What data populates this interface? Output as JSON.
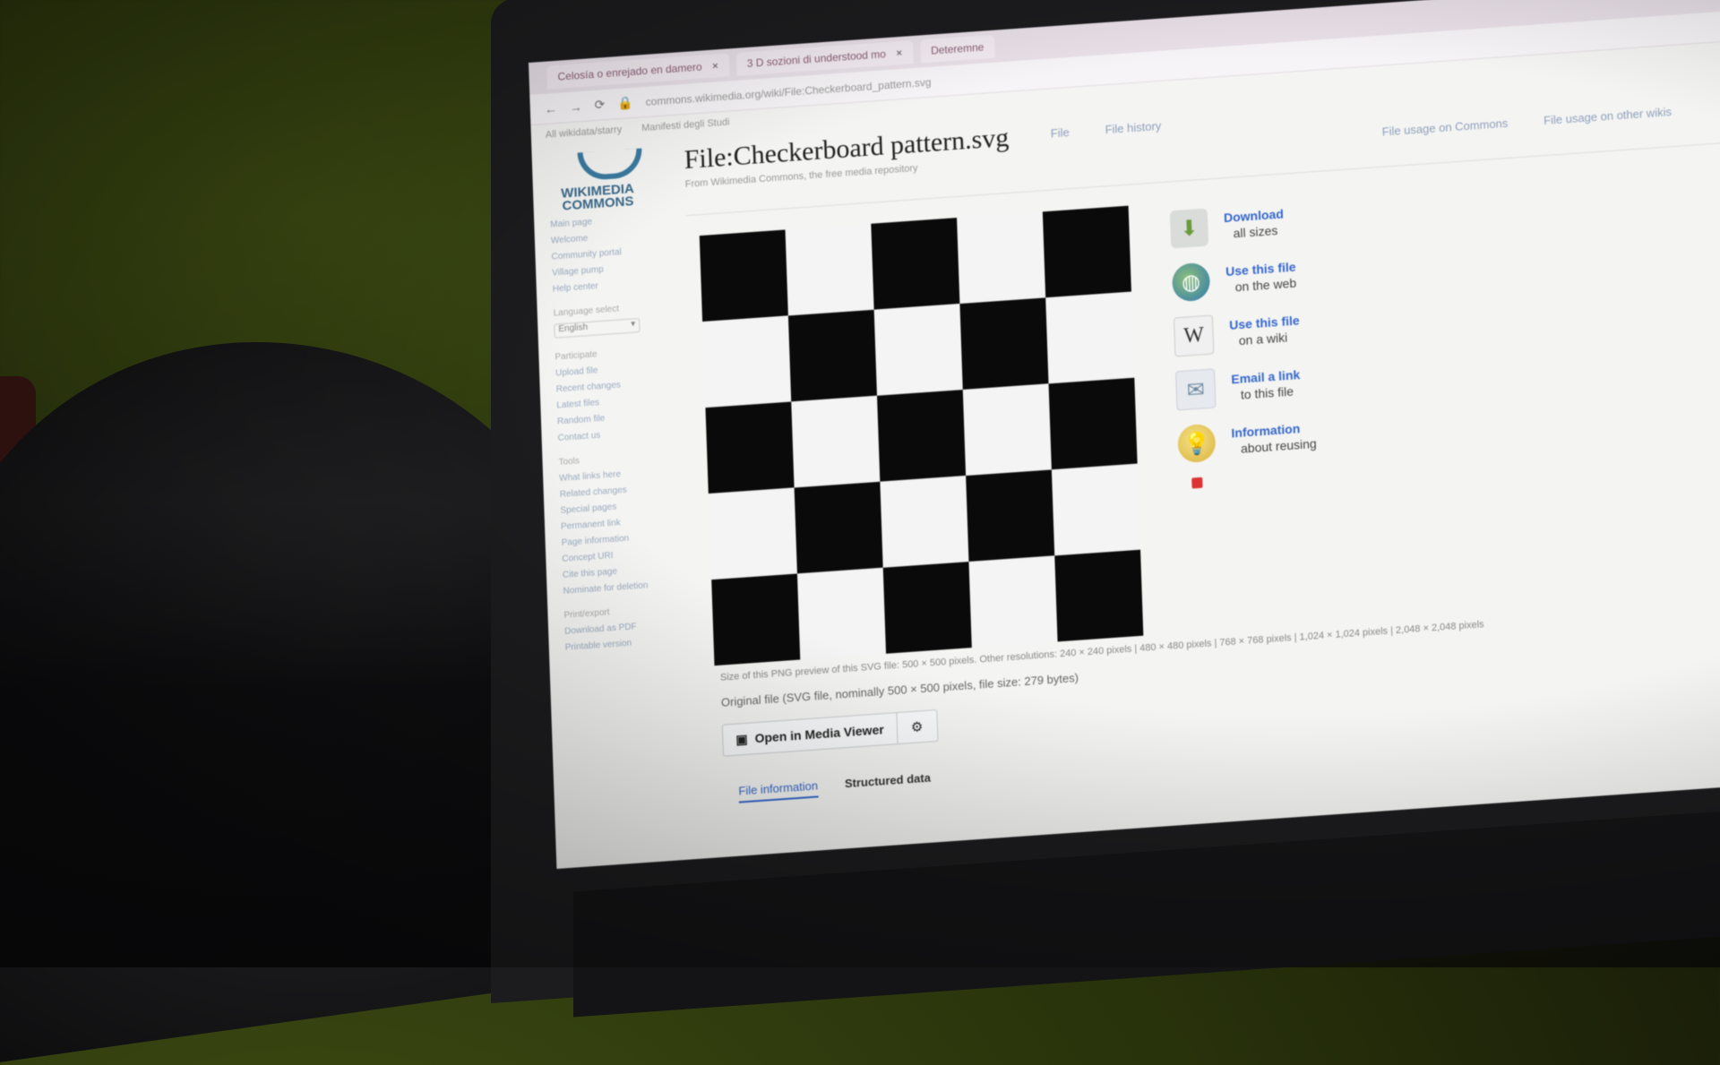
{
  "browser": {
    "tabs": [
      {
        "label": "Celosía o enrejado en damero",
        "close": "×"
      },
      {
        "label": "3 D sozioni di understood mo",
        "close": "×"
      },
      {
        "label": "Deteremne",
        "close": ""
      }
    ],
    "nav": {
      "back": "←",
      "forward": "→",
      "reload": "⟳",
      "lock": "🔒"
    },
    "url": "commons.wikimedia.org/wiki/File:Checkerboard_pattern.svg",
    "bookmarks": [
      "All   wikidata/starry",
      "Manifesti degli Studi"
    ]
  },
  "sidebar": {
    "logo_text": "WIKIMEDIA COMMONS",
    "main_links": [
      "Main page",
      "Welcome",
      "Community portal",
      "Village pump",
      "Help center"
    ],
    "language_heading": "Language select",
    "language_value": "English",
    "participate_heading": "Participate",
    "participate_links": [
      "Upload file",
      "Recent changes",
      "Latest files",
      "Random file",
      "Contact us"
    ],
    "tools_heading": "Tools",
    "tools_links": [
      "What links here",
      "Related changes",
      "Special pages",
      "Permanent link",
      "Page information",
      "Concept URI",
      "Cite this page",
      "Nominate for deletion"
    ],
    "print_heading": "Print/export",
    "print_links": [
      "Download as PDF",
      "Printable version"
    ]
  },
  "page": {
    "title": "File:Checkerboard pattern.svg",
    "subtitle": "From Wikimedia Commons, the free media repository",
    "tabs": [
      "File",
      "File history",
      "File usage on Commons",
      "File usage on other wikis"
    ],
    "resolution_line": "Size of this PNG preview of this SVG file: 500 × 500 pixels. Other resolutions: 240 × 240 pixels | 480 × 480 pixels | 768 × 768 pixels | 1,024 × 1,024 pixels | 2,048 × 2,048 pixels",
    "original_line": "Original file (SVG file, nominally 500 × 500 pixels, file size: 279 bytes)",
    "media_viewer_label": "Open in Media Viewer",
    "gear": "⚙",
    "bottom_tabs": [
      "File information",
      "Structured data"
    ]
  },
  "right_panel": [
    {
      "icon": "download-icon",
      "title": "Download",
      "sub": "all sizes"
    },
    {
      "icon": "globe-icon",
      "title": "Use this file",
      "sub": "on the web"
    },
    {
      "icon": "wikipedia-icon",
      "title": "Use this file",
      "sub": "on a wiki"
    },
    {
      "icon": "email-icon",
      "title": "Email a link",
      "sub": "to this file"
    },
    {
      "icon": "lightbulb-icon",
      "title": "Information",
      "sub": "about reusing"
    }
  ],
  "checkerboard": {
    "rows": 5,
    "cols": 5,
    "pattern": [
      [
        "b",
        "w",
        "b",
        "w",
        "b"
      ],
      [
        "w",
        "b",
        "w",
        "b",
        "w"
      ],
      [
        "b",
        "w",
        "b",
        "w",
        "b"
      ],
      [
        "w",
        "b",
        "w",
        "b",
        "w"
      ],
      [
        "b",
        "w",
        "b",
        "w",
        "b"
      ]
    ]
  },
  "colors": {
    "link": "#3366cc",
    "black_square": "#0a0a0a",
    "wall": "#2f3a0e"
  }
}
